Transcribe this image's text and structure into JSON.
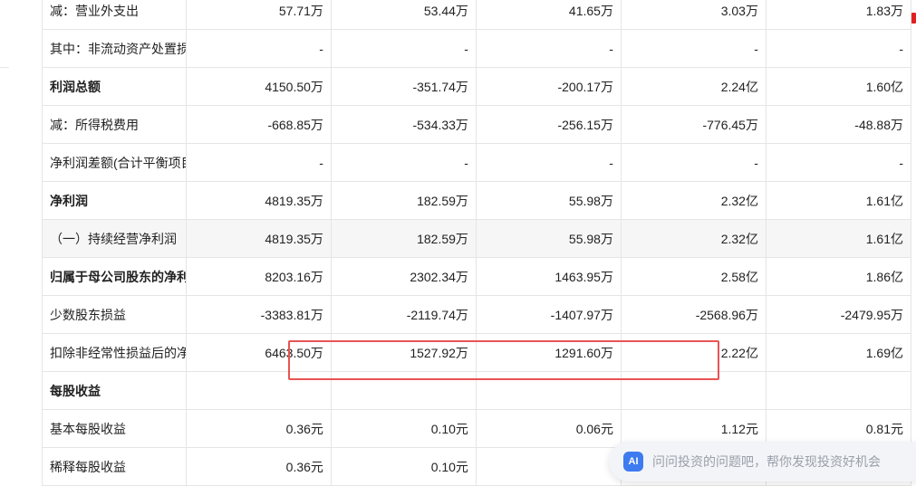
{
  "table": {
    "rows": [
      {
        "label": "减：营业外支出",
        "bold": false,
        "shade": false,
        "values": [
          "57.71万",
          "53.44万",
          "41.65万",
          "3.03万",
          "1.83万"
        ]
      },
      {
        "label": "其中：非流动资产处置损失",
        "bold": false,
        "shade": false,
        "values": [
          "-",
          "-",
          "-",
          "-",
          "-"
        ]
      },
      {
        "label": "利润总额",
        "bold": true,
        "shade": false,
        "values": [
          "4150.50万",
          "-351.74万",
          "-200.17万",
          "2.24亿",
          "1.60亿"
        ]
      },
      {
        "label": "减：所得税费用",
        "bold": false,
        "shade": false,
        "values": [
          "-668.85万",
          "-534.33万",
          "-256.15万",
          "-776.45万",
          "-48.88万"
        ]
      },
      {
        "label": "净利润差额(合计平衡项目)",
        "bold": false,
        "shade": false,
        "values": [
          "-",
          "-",
          "-",
          "-",
          "-"
        ]
      },
      {
        "label": "净利润",
        "bold": true,
        "shade": false,
        "values": [
          "4819.35万",
          "182.59万",
          "55.98万",
          "2.32亿",
          "1.61亿"
        ]
      },
      {
        "label": "（一）持续经营净利润",
        "bold": false,
        "shade": true,
        "values": [
          "4819.35万",
          "182.59万",
          "55.98万",
          "2.32亿",
          "1.61亿"
        ]
      },
      {
        "label": "归属于母公司股东的净利润",
        "bold": true,
        "shade": false,
        "values": [
          "8203.16万",
          "2302.34万",
          "1463.95万",
          "2.58亿",
          "1.86亿"
        ]
      },
      {
        "label": "少数股东损益",
        "bold": false,
        "shade": false,
        "values": [
          "-3383.81万",
          "-2119.74万",
          "-1407.97万",
          "-2568.96万",
          "-2479.95万"
        ]
      },
      {
        "label": "扣除非经常性损益后的净利润",
        "bold": false,
        "shade": false,
        "values": [
          "6463.50万",
          "1527.92万",
          "1291.60万",
          "2.22亿",
          "1.69亿"
        ]
      },
      {
        "label": "每股收益",
        "bold": true,
        "shade": false,
        "values": [
          "",
          "",
          "",
          "",
          ""
        ]
      },
      {
        "label": "基本每股收益",
        "bold": false,
        "shade": false,
        "values": [
          "0.36元",
          "0.10元",
          "0.06元",
          "1.12元",
          "0.81元"
        ]
      },
      {
        "label": "稀释每股收益",
        "bold": false,
        "shade": false,
        "values": [
          "0.36元",
          "0.10元",
          "",
          "",
          ""
        ]
      }
    ]
  },
  "ai_assistant": {
    "icon_text": "AI",
    "placeholder": "问问投资的问题吧，帮你发现投资好机会"
  },
  "colors": {
    "highlight_border": "#e85454",
    "ai_icon_bg": "#3d7bf0",
    "row_shade": "#f6f6f6"
  }
}
